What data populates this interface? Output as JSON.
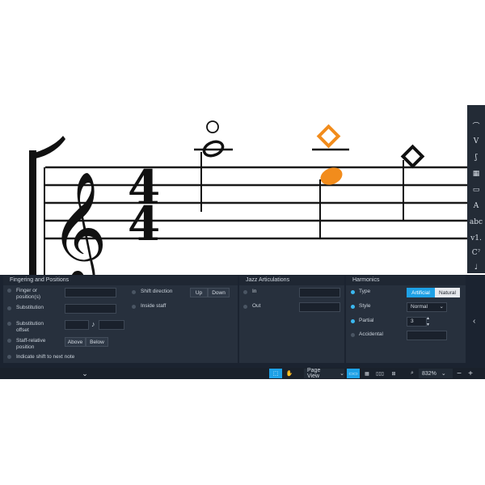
{
  "colors": {
    "accent": "#1ea1e6",
    "selected_note": "#f28c1c",
    "panel_bg": "#1b2330"
  },
  "score": {
    "time_sig_top": "4",
    "time_sig_bottom": "4"
  },
  "toolbar_icons": [
    "slur-icon",
    "v-flag-icon",
    "ear-icon",
    "clapper-icon",
    "comment-icon",
    "text-a-icon",
    "abc-text-icon",
    "v1-icon",
    "chord-c7-icon",
    "tempo-icon"
  ],
  "toolbar_glyphs": [
    "⌒",
    "V",
    "ʃ",
    "▦",
    "▭",
    "A",
    "abc",
    "v1.",
    "C⁷",
    "♩"
  ],
  "fingering": {
    "title": "Fingering and Positions",
    "finger_label": "Finger or position(s)",
    "substitution_label": "Substitution",
    "substitution_offset_label": "Substitution offset",
    "staff_relative_label": "Staff-relative position",
    "indicate_shift_label": "Indicate shift to next note",
    "shift_direction_label": "Shift direction",
    "inside_staff_label": "Inside staff",
    "up": "Up",
    "down": "Down",
    "above": "Above",
    "below": "Below",
    "note_glyph": "♪"
  },
  "jazz": {
    "title": "Jazz Articulations",
    "in": "In",
    "out": "Out"
  },
  "harmonics": {
    "title": "Harmonics",
    "type_label": "Type",
    "artificial": "Artificial",
    "natural": "Natural",
    "style_label": "Style",
    "style_value": "Normal",
    "partial_label": "Partial",
    "partial_value": "3",
    "accidental_label": "Accidental"
  },
  "status": {
    "view": "Page View",
    "zoom": "832%",
    "minus": "−",
    "plus": "+"
  }
}
